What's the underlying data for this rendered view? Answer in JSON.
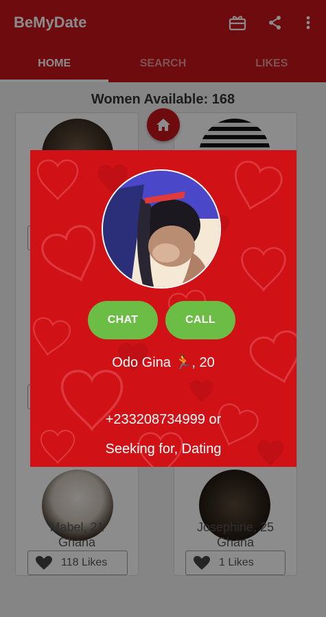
{
  "app": {
    "title": "BeMyDate"
  },
  "toolbar": {
    "icons": [
      "gift-icon",
      "share-icon",
      "more-vert-icon"
    ]
  },
  "tabs": [
    {
      "label": "HOME",
      "active": true
    },
    {
      "label": "SEARCH",
      "active": false
    },
    {
      "label": "LIKES",
      "active": false
    }
  ],
  "home": {
    "count_label": "Women Available: 168"
  },
  "cards": [
    {
      "name": "Mabel, 21",
      "country": "Ghana",
      "likes": "118 Likes"
    },
    {
      "name": "Josephine, 25",
      "country": "Ghana",
      "likes": "1 Likes"
    }
  ],
  "dialog": {
    "chat_label": "CHAT",
    "call_label": "CALL",
    "name_age": "Odo Gina 🏃, 20",
    "phone": "+233208734999 or",
    "seeking": "Seeking for, Dating"
  },
  "colors": {
    "primary": "#c8141b",
    "dialog_bg": "#d01217",
    "action_green": "#6cbd45"
  }
}
